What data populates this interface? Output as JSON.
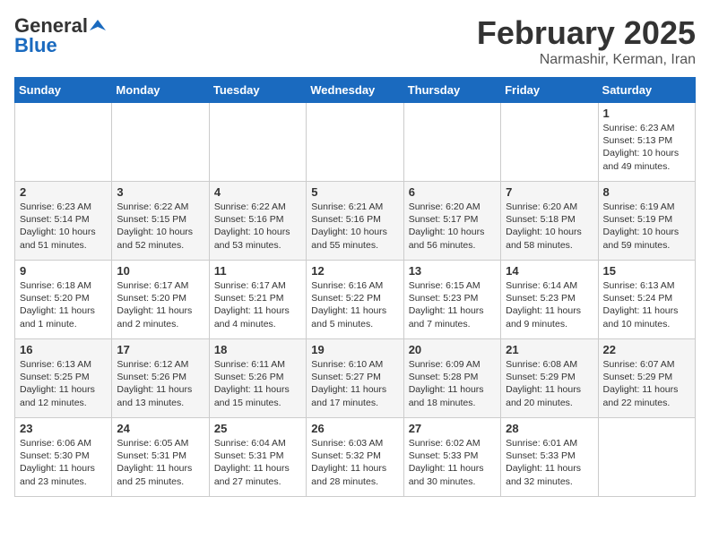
{
  "header": {
    "logo_general": "General",
    "logo_blue": "Blue",
    "month_title": "February 2025",
    "location": "Narmashir, Kerman, Iran"
  },
  "weekdays": [
    "Sunday",
    "Monday",
    "Tuesday",
    "Wednesday",
    "Thursday",
    "Friday",
    "Saturday"
  ],
  "weeks": [
    [
      {
        "day": "",
        "info": ""
      },
      {
        "day": "",
        "info": ""
      },
      {
        "day": "",
        "info": ""
      },
      {
        "day": "",
        "info": ""
      },
      {
        "day": "",
        "info": ""
      },
      {
        "day": "",
        "info": ""
      },
      {
        "day": "1",
        "info": "Sunrise: 6:23 AM\nSunset: 5:13 PM\nDaylight: 10 hours and 49 minutes."
      }
    ],
    [
      {
        "day": "2",
        "info": "Sunrise: 6:23 AM\nSunset: 5:14 PM\nDaylight: 10 hours and 51 minutes."
      },
      {
        "day": "3",
        "info": "Sunrise: 6:22 AM\nSunset: 5:15 PM\nDaylight: 10 hours and 52 minutes."
      },
      {
        "day": "4",
        "info": "Sunrise: 6:22 AM\nSunset: 5:16 PM\nDaylight: 10 hours and 53 minutes."
      },
      {
        "day": "5",
        "info": "Sunrise: 6:21 AM\nSunset: 5:16 PM\nDaylight: 10 hours and 55 minutes."
      },
      {
        "day": "6",
        "info": "Sunrise: 6:20 AM\nSunset: 5:17 PM\nDaylight: 10 hours and 56 minutes."
      },
      {
        "day": "7",
        "info": "Sunrise: 6:20 AM\nSunset: 5:18 PM\nDaylight: 10 hours and 58 minutes."
      },
      {
        "day": "8",
        "info": "Sunrise: 6:19 AM\nSunset: 5:19 PM\nDaylight: 10 hours and 59 minutes."
      }
    ],
    [
      {
        "day": "9",
        "info": "Sunrise: 6:18 AM\nSunset: 5:20 PM\nDaylight: 11 hours and 1 minute."
      },
      {
        "day": "10",
        "info": "Sunrise: 6:17 AM\nSunset: 5:20 PM\nDaylight: 11 hours and 2 minutes."
      },
      {
        "day": "11",
        "info": "Sunrise: 6:17 AM\nSunset: 5:21 PM\nDaylight: 11 hours and 4 minutes."
      },
      {
        "day": "12",
        "info": "Sunrise: 6:16 AM\nSunset: 5:22 PM\nDaylight: 11 hours and 5 minutes."
      },
      {
        "day": "13",
        "info": "Sunrise: 6:15 AM\nSunset: 5:23 PM\nDaylight: 11 hours and 7 minutes."
      },
      {
        "day": "14",
        "info": "Sunrise: 6:14 AM\nSunset: 5:23 PM\nDaylight: 11 hours and 9 minutes."
      },
      {
        "day": "15",
        "info": "Sunrise: 6:13 AM\nSunset: 5:24 PM\nDaylight: 11 hours and 10 minutes."
      }
    ],
    [
      {
        "day": "16",
        "info": "Sunrise: 6:13 AM\nSunset: 5:25 PM\nDaylight: 11 hours and 12 minutes."
      },
      {
        "day": "17",
        "info": "Sunrise: 6:12 AM\nSunset: 5:26 PM\nDaylight: 11 hours and 13 minutes."
      },
      {
        "day": "18",
        "info": "Sunrise: 6:11 AM\nSunset: 5:26 PM\nDaylight: 11 hours and 15 minutes."
      },
      {
        "day": "19",
        "info": "Sunrise: 6:10 AM\nSunset: 5:27 PM\nDaylight: 11 hours and 17 minutes."
      },
      {
        "day": "20",
        "info": "Sunrise: 6:09 AM\nSunset: 5:28 PM\nDaylight: 11 hours and 18 minutes."
      },
      {
        "day": "21",
        "info": "Sunrise: 6:08 AM\nSunset: 5:29 PM\nDaylight: 11 hours and 20 minutes."
      },
      {
        "day": "22",
        "info": "Sunrise: 6:07 AM\nSunset: 5:29 PM\nDaylight: 11 hours and 22 minutes."
      }
    ],
    [
      {
        "day": "23",
        "info": "Sunrise: 6:06 AM\nSunset: 5:30 PM\nDaylight: 11 hours and 23 minutes."
      },
      {
        "day": "24",
        "info": "Sunrise: 6:05 AM\nSunset: 5:31 PM\nDaylight: 11 hours and 25 minutes."
      },
      {
        "day": "25",
        "info": "Sunrise: 6:04 AM\nSunset: 5:31 PM\nDaylight: 11 hours and 27 minutes."
      },
      {
        "day": "26",
        "info": "Sunrise: 6:03 AM\nSunset: 5:32 PM\nDaylight: 11 hours and 28 minutes."
      },
      {
        "day": "27",
        "info": "Sunrise: 6:02 AM\nSunset: 5:33 PM\nDaylight: 11 hours and 30 minutes."
      },
      {
        "day": "28",
        "info": "Sunrise: 6:01 AM\nSunset: 5:33 PM\nDaylight: 11 hours and 32 minutes."
      },
      {
        "day": "",
        "info": ""
      }
    ]
  ]
}
